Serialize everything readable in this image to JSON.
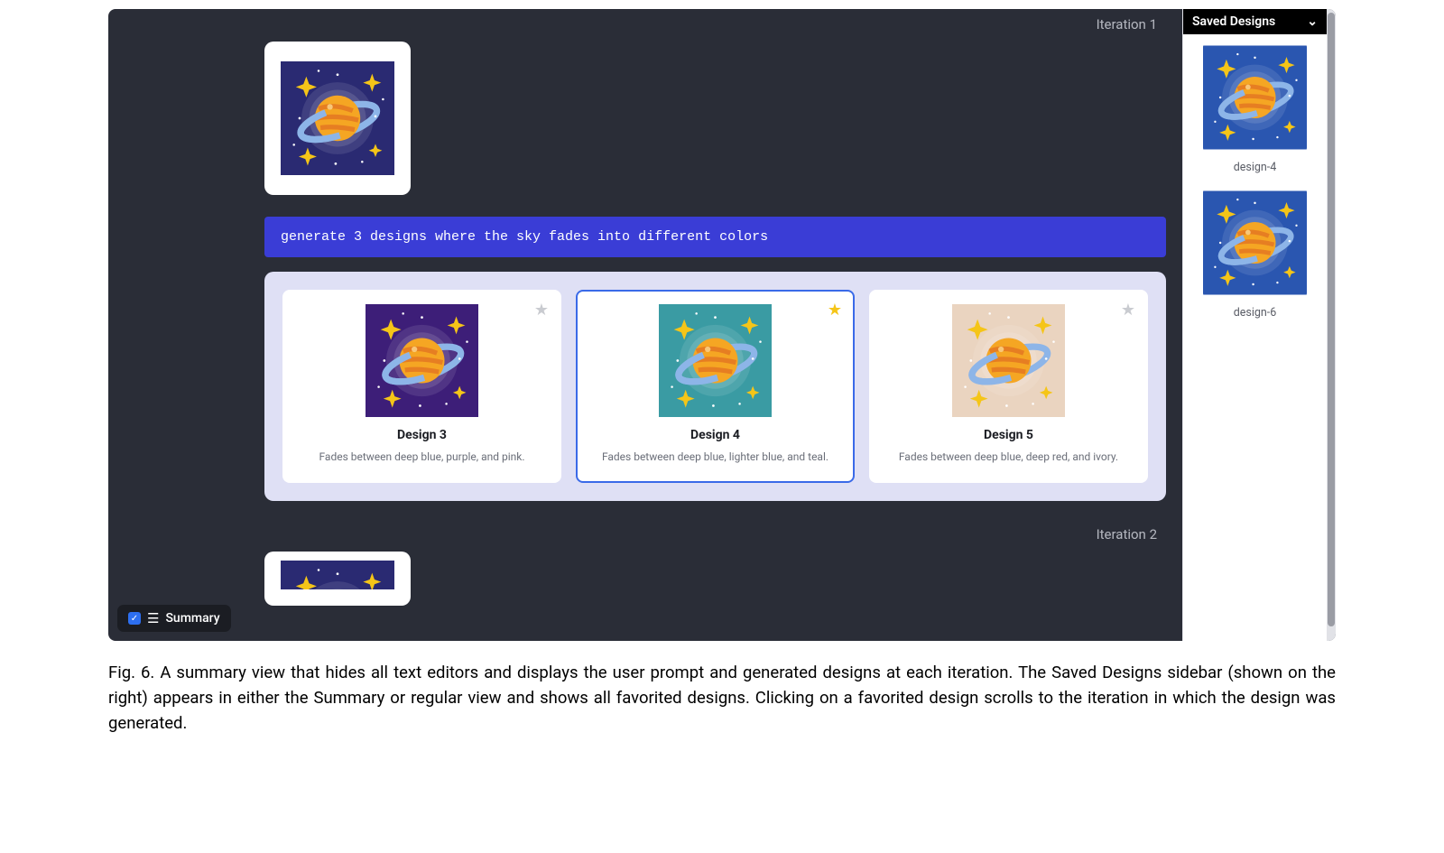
{
  "iterations": {
    "iter1": {
      "label": "Iteration 1",
      "prompt": "generate 3 designs where the sky fades into different colors",
      "designs": [
        {
          "title": "Design 3",
          "desc": "Fades between deep blue, purple, and pink.",
          "favorite": false,
          "selected": false,
          "bg": "purple"
        },
        {
          "title": "Design 4",
          "desc": "Fades between deep blue, lighter blue, and teal.",
          "favorite": true,
          "selected": true,
          "bg": "teal"
        },
        {
          "title": "Design 5",
          "desc": "Fades between deep blue, deep red, and ivory.",
          "favorite": false,
          "selected": false,
          "bg": "ivory"
        }
      ]
    },
    "iter2": {
      "label": "Iteration 2"
    }
  },
  "sidebar": {
    "title": "Saved Designs",
    "items": [
      {
        "label": "design-4"
      },
      {
        "label": "design-6"
      }
    ]
  },
  "summary_toggle": {
    "label": "Summary"
  },
  "caption": {
    "prefix": "Fig. 6.",
    "text": "A summary view that hides all text editors and displays the user prompt and generated designs at each iteration. The Saved Designs sidebar (shown on the right) appears in either the Summary or regular view and shows all favorited designs. Clicking on a favorited design scrolls to the iteration in which the design was generated."
  }
}
